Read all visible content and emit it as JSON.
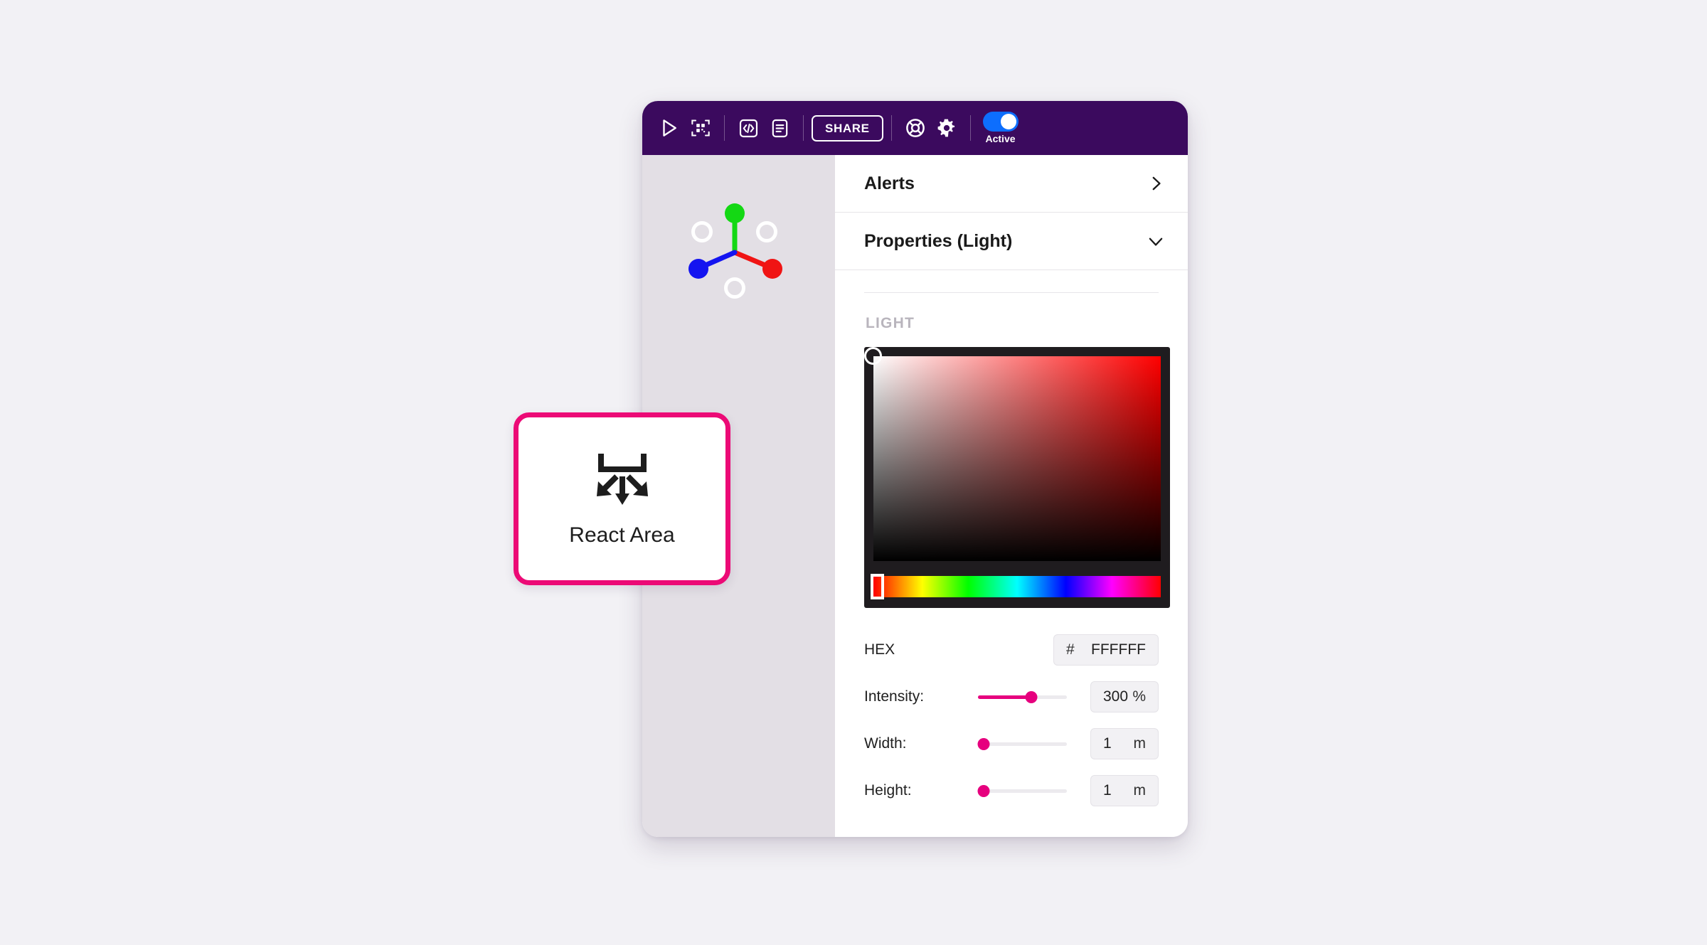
{
  "toolbar": {
    "icons": [
      {
        "name": "play-icon",
        "label": "Play"
      },
      {
        "name": "qr-scan-icon",
        "label": "Scan"
      },
      {
        "name": "code-icon",
        "label": "Code"
      },
      {
        "name": "document-icon",
        "label": "Document"
      },
      {
        "name": "life-ring-icon",
        "label": "Help"
      },
      {
        "name": "gear-icon",
        "label": "Settings"
      }
    ],
    "share_label": "SHARE",
    "toggle_label": "Active",
    "toggle_on": true,
    "background_color": "#3B0A5E",
    "toggle_color": "#0D6EFD"
  },
  "viewport": {
    "background_color": "#E3DFE5",
    "gizmo": {
      "x_axis_color": "#F01414",
      "y_axis_color": "#14D814",
      "z_axis_color": "#1414F0",
      "negative_handle_color": "#FFFFFF"
    }
  },
  "panel": {
    "sections": [
      {
        "title": "Alerts",
        "chevron": "chevron-right-icon",
        "expanded": false
      },
      {
        "title": "Properties (Light)",
        "chevron": "chevron-down-icon",
        "expanded": true
      }
    ],
    "group_label": "LIGHT",
    "color_picker": {
      "selected_hex": "FFFFFF",
      "hue_position_pct": 0,
      "sv_handle_x_pct": 0,
      "sv_handle_y_pct": 0,
      "frame_color": "#1F1C1F"
    },
    "properties": [
      {
        "label": "HEX",
        "hash_symbol": "#",
        "value": "FFFFFF",
        "type": "hex"
      },
      {
        "label": "Intensity:",
        "value": "300",
        "unit": "%",
        "slider_pct": 60,
        "type": "slider"
      },
      {
        "label": "Width:",
        "value": "1",
        "unit": "m",
        "slider_pct": 4,
        "type": "slider"
      },
      {
        "label": "Height:",
        "value": "1",
        "unit": "m",
        "slider_pct": 4,
        "type": "slider"
      }
    ],
    "accent_color": "#E6007E"
  },
  "react_area_card": {
    "label": "React Area",
    "icon": "react-area-icon",
    "border_color": "#EC0A76"
  }
}
